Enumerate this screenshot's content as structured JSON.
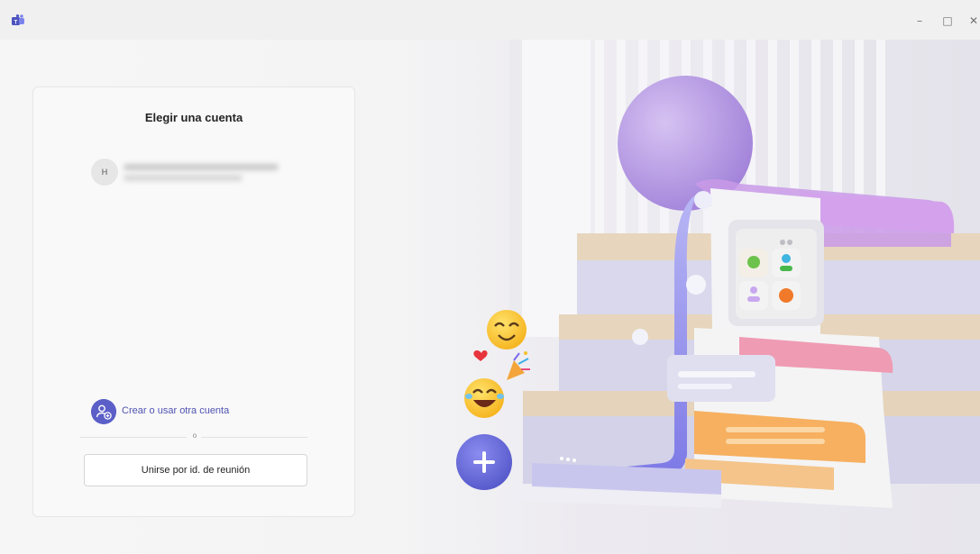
{
  "window": {
    "controls": {
      "minimize": "–",
      "maximize": "□",
      "close": "✕"
    }
  },
  "card": {
    "title": "Elegir una cuenta",
    "account": {
      "avatar_initial": "H"
    },
    "create_account_label": "Crear o usar otra cuenta",
    "divider_text": "o",
    "join_button_label": "Unirse por id. de reunión"
  },
  "colors": {
    "brand": "#5b5fc7",
    "brand_text": "#4f52b2"
  },
  "icons": {
    "app": "teams-logo-icon",
    "create": "person-add-icon",
    "plus": "plus-icon"
  }
}
